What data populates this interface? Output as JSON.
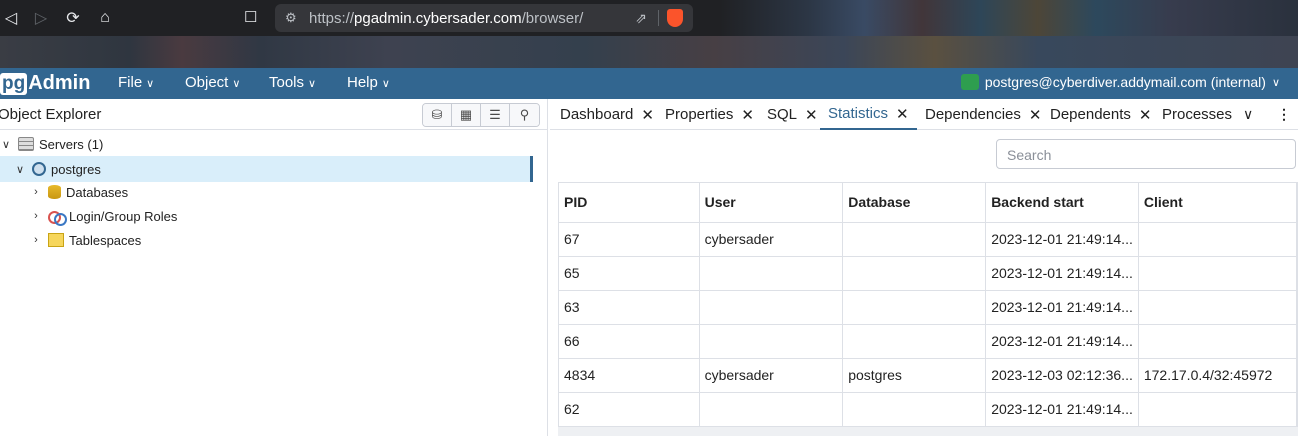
{
  "browser": {
    "url_prefix": "https://",
    "url_host": "pgadmin.cybersader.com",
    "url_path": "/browser/",
    "back_icon": "back-arrow",
    "forward_icon": "forward-arrow",
    "reload_icon": "reload",
    "home_icon": "home",
    "bookmark_icon": "bookmark",
    "share_icon": "share",
    "brave_icon": "brave-lion"
  },
  "app": {
    "logo_pg": "pg",
    "logo_admin": "Admin",
    "menu": [
      "File",
      "Object",
      "Tools",
      "Help"
    ],
    "user": "postgres@cyberdiver.addymail.com (internal)",
    "header_color": "#326690"
  },
  "explorer": {
    "title": "Object Explorer",
    "tools": [
      "query-tool-icon",
      "view-data-icon",
      "filter-rows-icon",
      "search-objects-icon"
    ],
    "tree": [
      {
        "label": "Servers (1)",
        "expanded": true
      },
      {
        "label": "postgres",
        "expanded": true
      },
      {
        "label": "Databases",
        "expanded": false
      },
      {
        "label": "Login/Group Roles",
        "expanded": false
      },
      {
        "label": "Tablespaces",
        "expanded": false
      }
    ]
  },
  "tabs": [
    {
      "label": "Dashboard",
      "active": false
    },
    {
      "label": "Properties",
      "active": false
    },
    {
      "label": "SQL",
      "active": false
    },
    {
      "label": "Statistics",
      "active": true
    },
    {
      "label": "Dependencies",
      "active": false
    },
    {
      "label": "Dependents",
      "active": false
    },
    {
      "label": "Processes",
      "active": false
    }
  ],
  "search": {
    "placeholder": "Search"
  },
  "grid": {
    "columns": [
      "PID",
      "User",
      "Database",
      "Backend start",
      "Client"
    ],
    "rows": [
      [
        "67",
        "cybersader",
        "",
        "2023-12-01 21:49:14...",
        ""
      ],
      [
        "65",
        "",
        "",
        "2023-12-01 21:49:14...",
        ""
      ],
      [
        "63",
        "",
        "",
        "2023-12-01 21:49:14...",
        ""
      ],
      [
        "66",
        "",
        "",
        "2023-12-01 21:49:14...",
        ""
      ],
      [
        "4834",
        "cybersader",
        "postgres",
        "2023-12-03 02:12:36...",
        "172.17.0.4/32:45972"
      ],
      [
        "62",
        "",
        "",
        "2023-12-01 21:49:14...",
        ""
      ]
    ]
  }
}
